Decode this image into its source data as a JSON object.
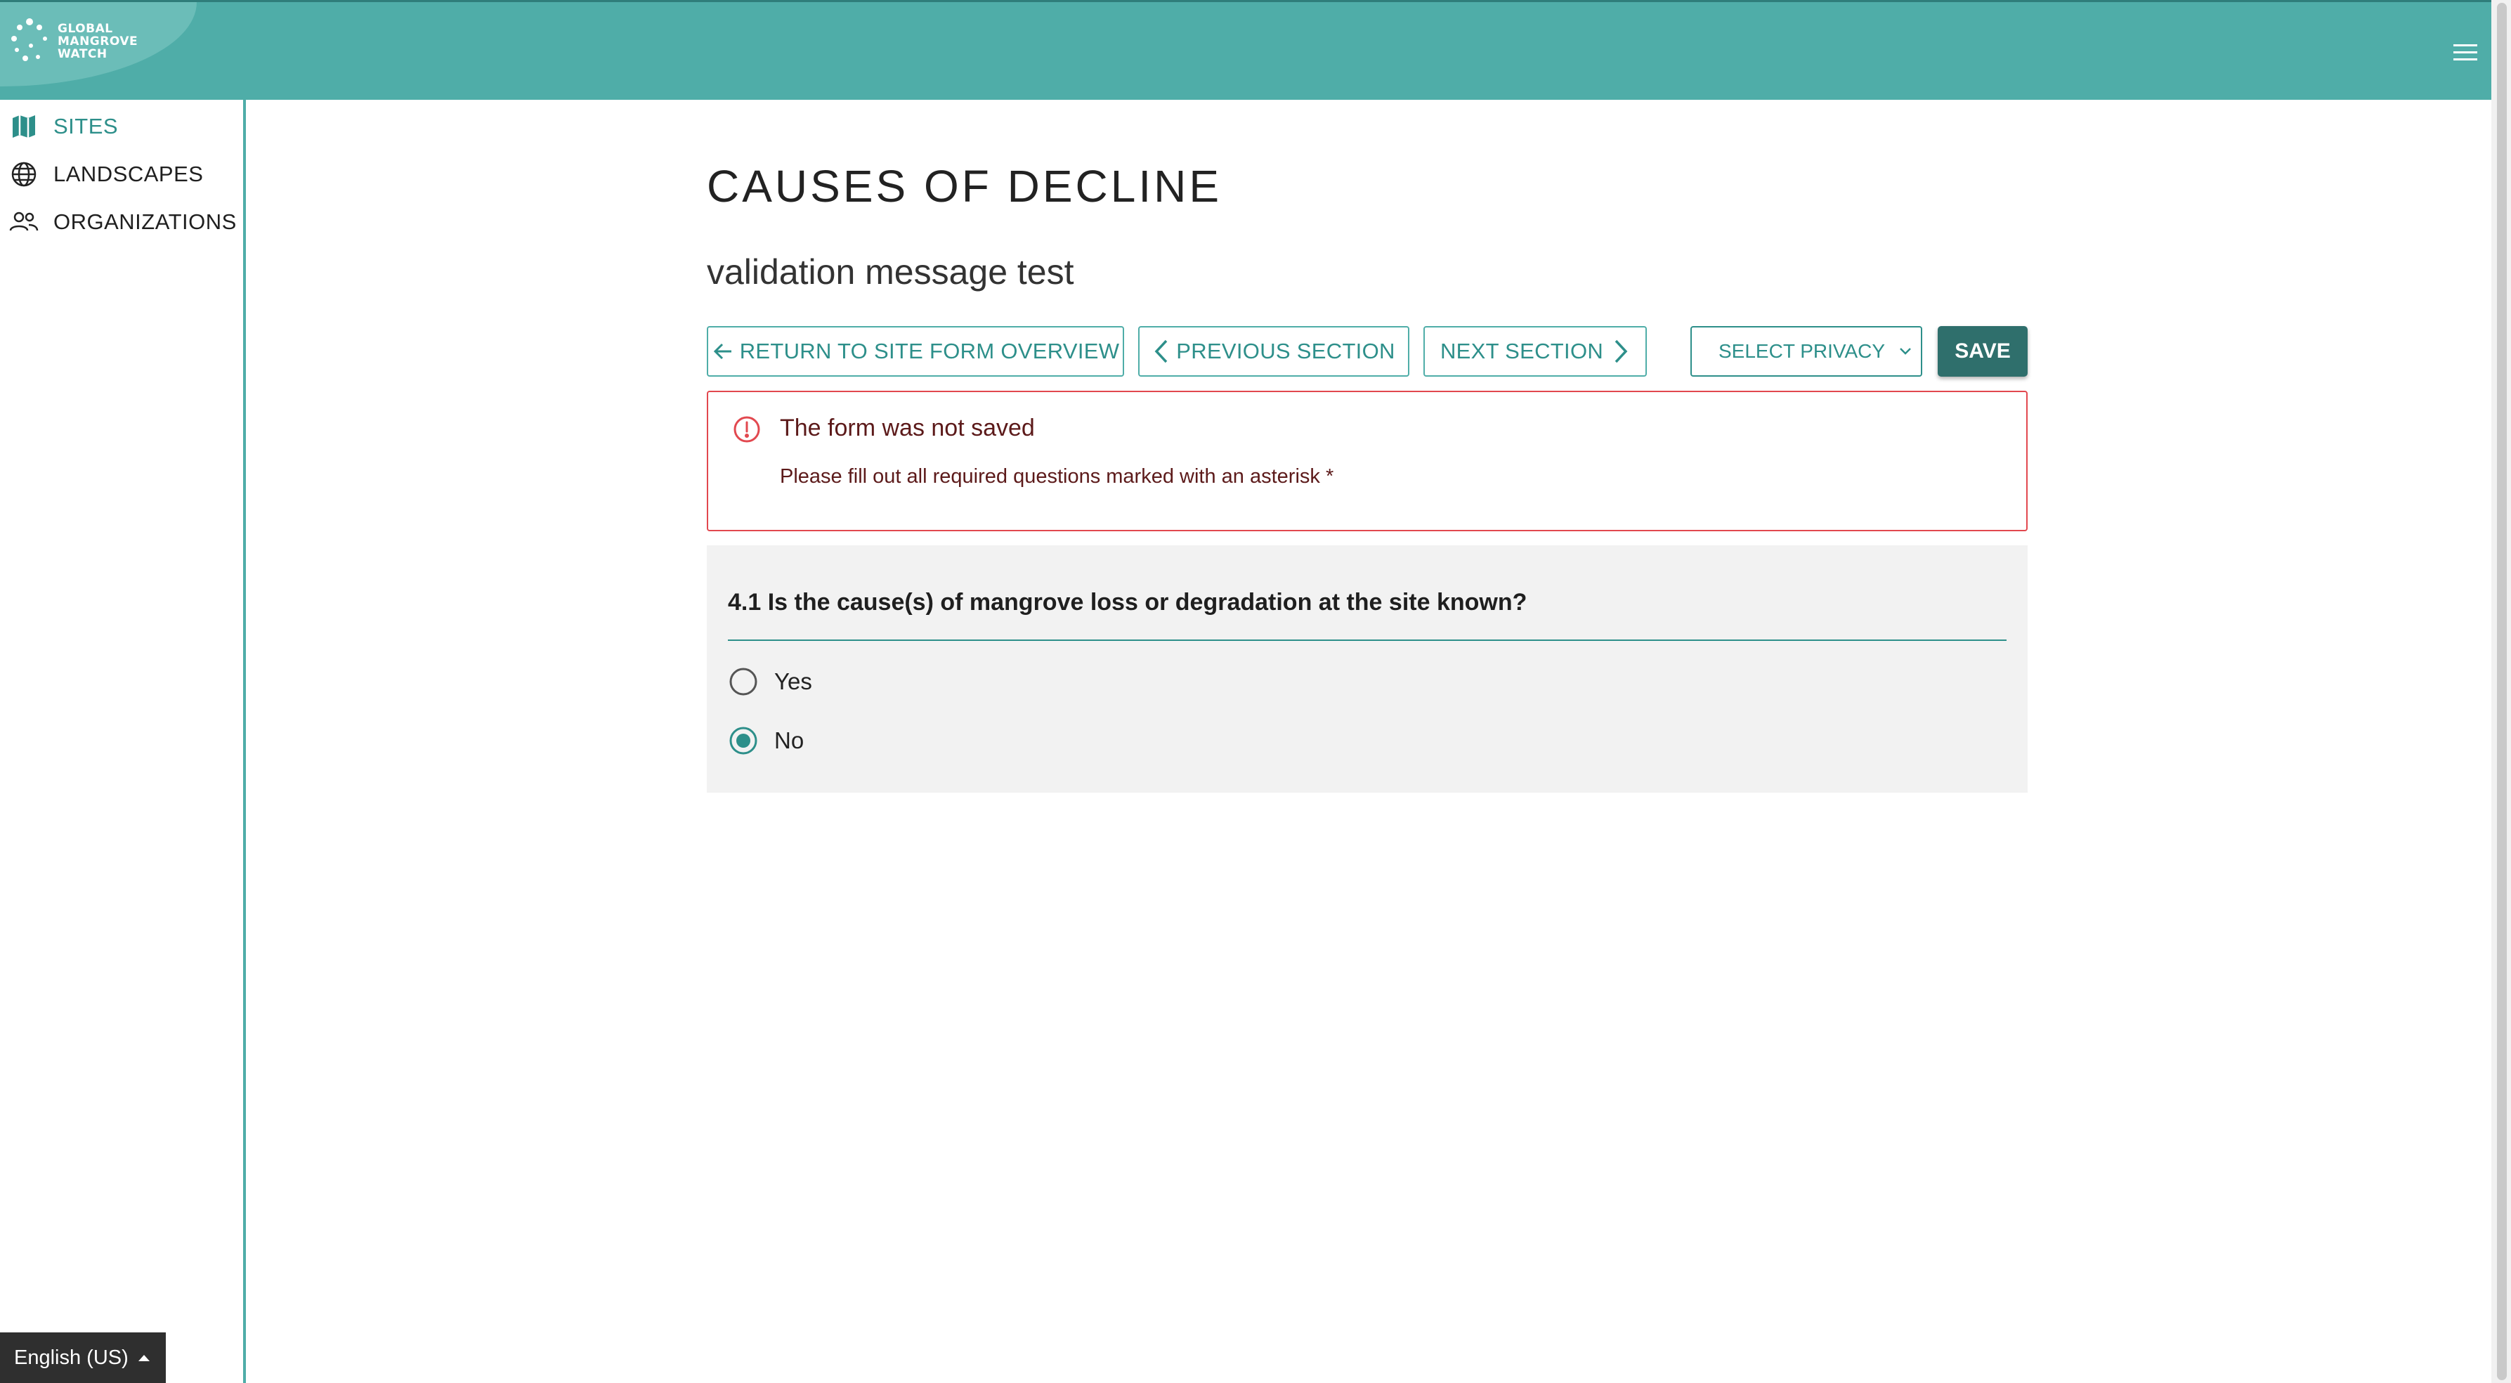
{
  "header": {
    "logo_lines": [
      "GLOBAL",
      "MANGROVE",
      "WATCH"
    ]
  },
  "sidebar": {
    "items": [
      {
        "label": "SITES",
        "icon": "map-icon",
        "active": true
      },
      {
        "label": "LANDSCAPES",
        "icon": "globe-icon",
        "active": false
      },
      {
        "label": "ORGANIZATIONS",
        "icon": "users-icon",
        "active": false
      }
    ],
    "language": "English (US)"
  },
  "page": {
    "title": "CAUSES OF DECLINE",
    "subtitle": "validation message test"
  },
  "toolbar": {
    "return_label": "RETURN TO SITE FORM OVERVIEW",
    "previous_label": "PREVIOUS SECTION",
    "next_label": "NEXT SECTION",
    "privacy_label": "SELECT PRIVACY",
    "save_label": "SAVE"
  },
  "alert": {
    "title": "The form was not saved",
    "message": "Please fill out all required questions marked with an asterisk *"
  },
  "question": {
    "title": "4.1 Is the cause(s) of mangrove loss or degradation at the site known?",
    "options": [
      {
        "label": "Yes",
        "selected": false
      },
      {
        "label": "No",
        "selected": true
      }
    ]
  },
  "colors": {
    "header": "#4fada8",
    "accent": "#2d8f8a",
    "save_button": "#2f6f6c",
    "error": "#e2484f"
  }
}
